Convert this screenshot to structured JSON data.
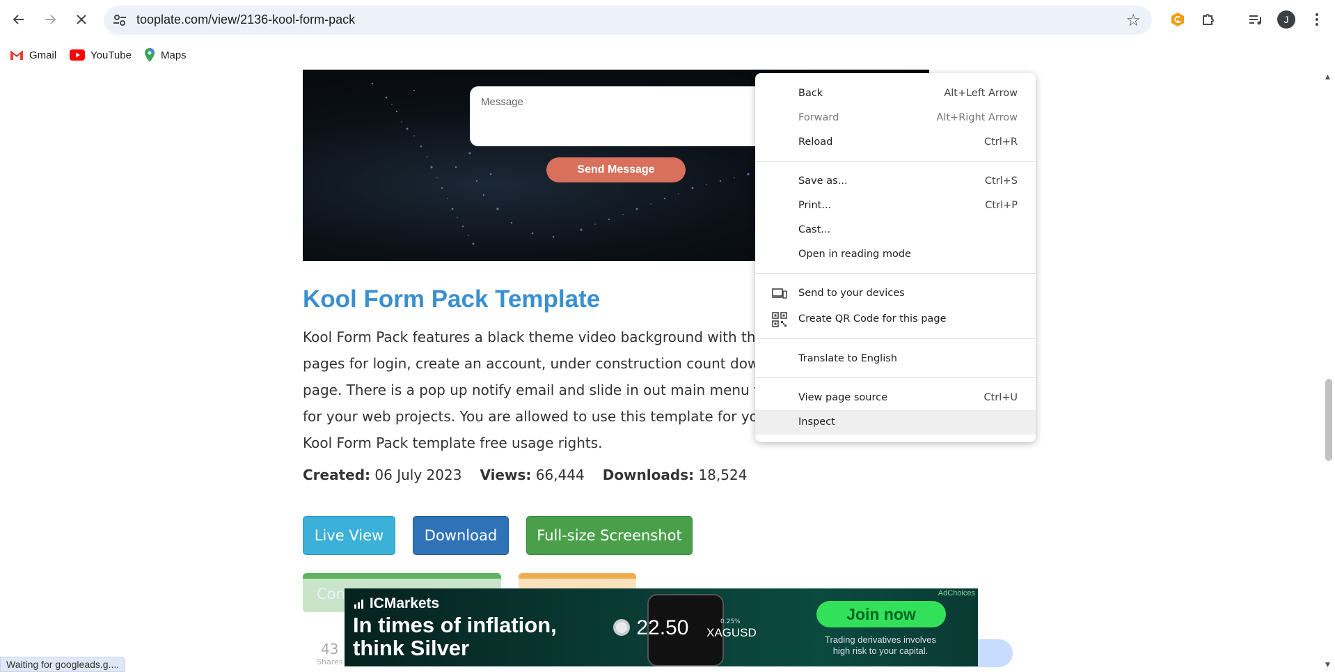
{
  "browser": {
    "url": "tooplate.com/view/2136-kool-form-pack",
    "avatar_letter": "J",
    "bookmarks": [
      {
        "label": "Gmail",
        "icon": "gmail-icon"
      },
      {
        "label": "YouTube",
        "icon": "youtube-icon"
      },
      {
        "label": "Maps",
        "icon": "maps-icon"
      }
    ],
    "status_text": "Waiting for googleads.g...."
  },
  "hero": {
    "message_placeholder": "Message",
    "send_button": "Send Message"
  },
  "page": {
    "title": "Kool Form Pack Template",
    "description_lines": [
      "Kool Form Pack features a black theme video background with the use o",
      "pages for login, create an account, under construction count down, pass",
      "page. There is a pop up notify email and slide in out main menu from the",
      "for your web projects. You are allowed to use this template for your com",
      "Kool Form Pack template free usage rights."
    ],
    "meta": {
      "created_label": "Created:",
      "created_value": "06 July 2023",
      "views_label": "Views:",
      "views_value": "66,444",
      "downloads_label": "Downloads:",
      "downloads_value": "18,524"
    },
    "buttons": {
      "live_view": "Live View",
      "download": "Download",
      "screenshot": "Full-size Screenshot",
      "faded_partial": "Con"
    },
    "shares_count": "43",
    "shares_label": "Shares"
  },
  "ad": {
    "brand": "ICMarkets",
    "headline_line1": "In times of inflation,",
    "headline_line2": "think Silver",
    "price": "22.50",
    "symbol": "XAGUSD",
    "change": "0.25%",
    "cta": "Join now",
    "disclaimer_line1": "Trading derivatives involves",
    "disclaimer_line2": "high risk to your capital.",
    "adchoices": "AdChoices"
  },
  "context_menu": {
    "items": [
      {
        "label": "Back",
        "shortcut": "Alt+Left Arrow",
        "disabled": false
      },
      {
        "label": "Forward",
        "shortcut": "Alt+Right Arrow",
        "disabled": true
      },
      {
        "label": "Reload",
        "shortcut": "Ctrl+R",
        "disabled": false
      },
      {
        "label": "Save as...",
        "shortcut": "Ctrl+S",
        "disabled": false
      },
      {
        "label": "Print...",
        "shortcut": "Ctrl+P",
        "disabled": false
      },
      {
        "label": "Cast...",
        "shortcut": "",
        "disabled": false
      },
      {
        "label": "Open in reading mode",
        "shortcut": "",
        "disabled": false
      },
      {
        "label": "Send to your devices",
        "shortcut": "",
        "disabled": false,
        "icon": "devices-icon"
      },
      {
        "label": "Create QR Code for this page",
        "shortcut": "",
        "disabled": false,
        "icon": "qr-code-icon"
      },
      {
        "label": "Translate to English",
        "shortcut": "",
        "disabled": false
      },
      {
        "label": "View page source",
        "shortcut": "Ctrl+U",
        "disabled": false
      },
      {
        "label": "Inspect",
        "shortcut": "",
        "disabled": false,
        "hovered": true
      }
    ]
  },
  "colors": {
    "title_blue": "#3a8fd1",
    "live_view": "#3bb0d8",
    "download": "#2f73b6",
    "screenshot": "#4aa04a",
    "send_button": "#d9705c",
    "ad_cta": "#33e05a"
  }
}
